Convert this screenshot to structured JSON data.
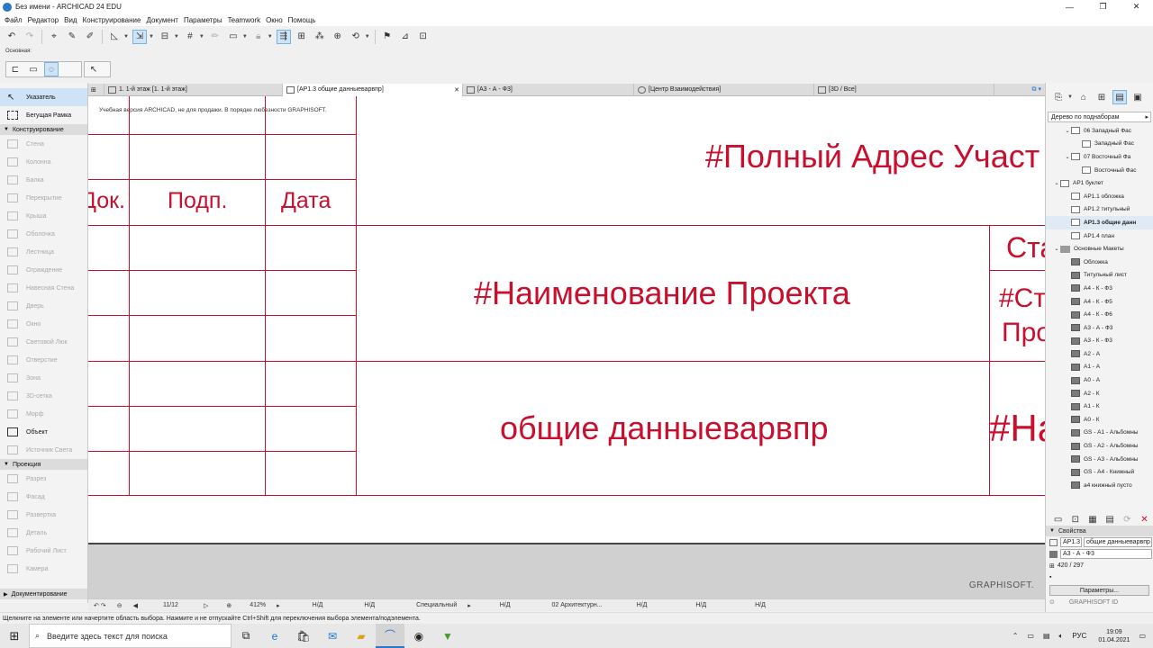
{
  "window": {
    "title": "Без имени - ARCHICAD 24 EDU",
    "minimize": "—",
    "maximize": "❐",
    "close": "✕"
  },
  "menu": [
    "Файл",
    "Редактор",
    "Вид",
    "Конструирование",
    "Документ",
    "Параметры",
    "Teamwork",
    "Окно",
    "Помощь"
  ],
  "infobox_label": "Основная:",
  "tabs": [
    {
      "label": "1. 1-й этаж [1. 1-й этаж]",
      "active": false
    },
    {
      "label": "[АР1.3 общие данныеварвпр]",
      "active": true,
      "close": "✕"
    },
    {
      "label": "[А3 - А - Ф3]",
      "active": false
    },
    {
      "label": "[Центр Взаимодействия]",
      "active": false
    },
    {
      "label": "[3D / Все]",
      "active": false
    }
  ],
  "toolbox": {
    "top_tools": [
      {
        "label": "Указатель",
        "selected": true
      },
      {
        "label": "Бегущая Рамка",
        "selected": false
      }
    ],
    "sections": [
      {
        "title": "Конструирование",
        "tools": [
          {
            "label": "Стена",
            "active": false
          },
          {
            "label": "Колонна",
            "active": false
          },
          {
            "label": "Балка",
            "active": false
          },
          {
            "label": "Перекрытие",
            "active": false
          },
          {
            "label": "Крыша",
            "active": false
          },
          {
            "label": "Оболочка",
            "active": false
          },
          {
            "label": "Лестница",
            "active": false
          },
          {
            "label": "Ограждение",
            "active": false
          },
          {
            "label": "Навесная Стена",
            "active": false
          },
          {
            "label": "Дверь",
            "active": false
          },
          {
            "label": "Окно",
            "active": false
          },
          {
            "label": "Световой Люк",
            "active": false
          },
          {
            "label": "Отверстие",
            "active": false
          },
          {
            "label": "Зона",
            "active": false
          },
          {
            "label": "3D-сетка",
            "active": false
          },
          {
            "label": "Морф",
            "active": false
          },
          {
            "label": "Объект",
            "active": true
          },
          {
            "label": "Источник Света",
            "active": false
          }
        ]
      },
      {
        "title": "Проекция",
        "tools": [
          {
            "label": "Разрез",
            "active": false
          },
          {
            "label": "Фасад",
            "active": false
          },
          {
            "label": "Развертка",
            "active": false
          },
          {
            "label": "Деталь",
            "active": false
          },
          {
            "label": "Рабочий Лист",
            "active": false
          },
          {
            "label": "Камера",
            "active": false
          }
        ]
      }
    ],
    "bottom_section": "Документирование"
  },
  "canvas": {
    "watermark": "Учебная версия ARCHICAD, не для продажи. В порядке любезности GRAPHISOFT.",
    "col_dok": "Док.",
    "col_podp": "Подп.",
    "col_data": "Дата",
    "address": "#Полный Адрес Участ",
    "project_name": "#Наименование Проекта",
    "sheet_name": "общие данныеварвпр",
    "right_1": "Ста",
    "right_2a": "#Ст",
    "right_2b": "Про",
    "right_3": "#На",
    "brand": "GRAPHISOFT."
  },
  "status": {
    "page": "11/12",
    "zoom": "412%",
    "nd": "Н/Д",
    "mode": "Специальный",
    "layer": "02 Архитектурн..."
  },
  "hint": "Щелкните на элементе или начертите область выбора. Нажмите и не отпускайте Ctrl+Shift для переключения выбора элемента/подэлемента.",
  "navigator": {
    "dropdown": "Дерево по поднаборам",
    "items": [
      {
        "label": "06 Западный Фас",
        "indent": 2,
        "icon": "sq",
        "arrow": "⌄"
      },
      {
        "label": "Западный Фас",
        "indent": 3,
        "icon": "sq"
      },
      {
        "label": "07 Восточный Фа",
        "indent": 2,
        "icon": "sq",
        "arrow": "⌄"
      },
      {
        "label": "Восточный Фас",
        "indent": 3,
        "icon": "sq"
      },
      {
        "label": "АР1 буклет",
        "indent": 1,
        "icon": "sq",
        "arrow": "⌄"
      },
      {
        "label": "АР1.1 обложка",
        "indent": 2,
        "icon": "sq"
      },
      {
        "label": "АР1.2 титульный",
        "indent": 2,
        "icon": "sq"
      },
      {
        "label": "АР1.3 общие данн",
        "indent": 2,
        "icon": "sq",
        "selected": true
      },
      {
        "label": "АР1.4 план",
        "indent": 2,
        "icon": "sq"
      },
      {
        "label": "Основные Макеты",
        "indent": 1,
        "icon": "fold",
        "arrow": "⌄"
      },
      {
        "label": "Обложка",
        "indent": 2,
        "icon": "dark"
      },
      {
        "label": "Титульный лист",
        "indent": 2,
        "icon": "dark"
      },
      {
        "label": "А4 - К - Ф3",
        "indent": 2,
        "icon": "dark"
      },
      {
        "label": "А4 - К - Ф5",
        "indent": 2,
        "icon": "dark"
      },
      {
        "label": "А4 - К - Ф6",
        "indent": 2,
        "icon": "dark"
      },
      {
        "label": "А3 - А - Ф3",
        "indent": 2,
        "icon": "dark"
      },
      {
        "label": "А3 - К - Ф3",
        "indent": 2,
        "icon": "dark"
      },
      {
        "label": "А2 - А",
        "indent": 2,
        "icon": "dark"
      },
      {
        "label": "А1 - А",
        "indent": 2,
        "icon": "dark"
      },
      {
        "label": "А0 - А",
        "indent": 2,
        "icon": "dark"
      },
      {
        "label": "А2 - К",
        "indent": 2,
        "icon": "dark"
      },
      {
        "label": "А1 - К",
        "indent": 2,
        "icon": "dark"
      },
      {
        "label": "А0 - К",
        "indent": 2,
        "icon": "dark"
      },
      {
        "label": "GS - А1 - Альбомны",
        "indent": 2,
        "icon": "dark"
      },
      {
        "label": "GS - А2 - Альбомны",
        "indent": 2,
        "icon": "dark"
      },
      {
        "label": "GS - А3 - Альбомны",
        "indent": 2,
        "icon": "dark"
      },
      {
        "label": "GS - А4 - Книжный",
        "indent": 2,
        "icon": "dark"
      },
      {
        "label": "а4 книжный пусто",
        "indent": 2,
        "icon": "dark"
      }
    ],
    "props_title": "Свойства",
    "prop_id": "АР1.3",
    "prop_name": "общие данныеварвпр",
    "prop_layout": "А3 - А - Ф3",
    "prop_size": "420 / 297",
    "params_button": "Параметры...",
    "brand": "GRAPHISOFT ID"
  },
  "taskbar": {
    "search_placeholder": "Введите здесь текст для поиска",
    "lang": "РУС",
    "time": "19:09",
    "date": "01.04.2021"
  },
  "colors": {
    "accent_red": "#c8102e",
    "selection_blue": "#cfe3f6"
  }
}
